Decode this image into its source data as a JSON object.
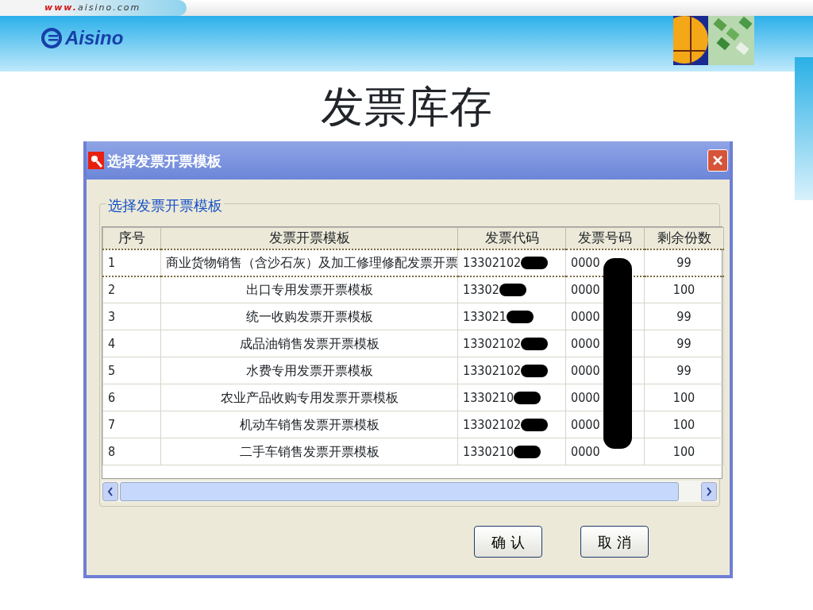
{
  "site_url": {
    "prefix": "www.",
    "domain": "aisino.com"
  },
  "logo": {
    "text": "Aisino"
  },
  "slide_title": "发票库存",
  "dialog": {
    "title": "选择发票开票模板",
    "group_label": "选择发票开票模板",
    "table": {
      "columns": [
        "序号",
        "发票开票模板",
        "发票代码",
        "发票号码",
        "剩余份数"
      ],
      "rows": [
        {
          "cells": [
            "1",
            "商业货物销售（含沙石灰）及加工修理修配发票开票",
            "13302102",
            "0000",
            "99"
          ],
          "selected": true
        },
        {
          "cells": [
            "2",
            "出口专用发票开票模板",
            "13302",
            "0000",
            "100"
          ],
          "selected": false
        },
        {
          "cells": [
            "3",
            "统一收购发票开票模板",
            "133021",
            "0000",
            "99"
          ],
          "selected": false
        },
        {
          "cells": [
            "4",
            "成品油销售发票开票模板",
            "13302102",
            "0000",
            "99"
          ],
          "selected": false
        },
        {
          "cells": [
            "5",
            "水费专用发票开票模板",
            "13302102",
            "0000",
            "99"
          ],
          "selected": false
        },
        {
          "cells": [
            "6",
            "农业产品收购专用发票开票模板",
            "1330210",
            "0000",
            "100"
          ],
          "selected": false
        },
        {
          "cells": [
            "7",
            "机动车销售发票开票模板",
            "13302102",
            "0000",
            "100"
          ],
          "selected": false
        },
        {
          "cells": [
            "8",
            "二手车销售发票开票模板",
            "1330210",
            "0000",
            "100"
          ],
          "selected": false
        }
      ]
    },
    "buttons": [
      "确 认",
      "取 消"
    ]
  }
}
